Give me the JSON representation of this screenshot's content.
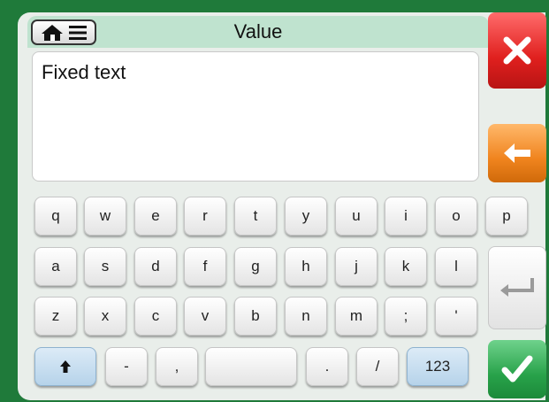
{
  "header": {
    "title": "Value"
  },
  "editor": {
    "value": "Fixed text"
  },
  "keyboard": {
    "row1": [
      "q",
      "w",
      "e",
      "r",
      "t",
      "y",
      "u",
      "i",
      "o",
      "p"
    ],
    "row2": [
      "a",
      "s",
      "d",
      "f",
      "g",
      "h",
      "j",
      "k",
      "l"
    ],
    "row3": [
      "z",
      "x",
      "c",
      "v",
      "b",
      "n",
      "m",
      ";",
      "'"
    ],
    "row4": {
      "minus": "-",
      "comma": ",",
      "period": ".",
      "slash": "/",
      "numbers": "123"
    }
  },
  "icons": {
    "home": "home-icon",
    "menu": "menu-icon",
    "close": "close-icon",
    "back": "arrow-left-icon",
    "enter": "enter-icon",
    "ok": "checkmark-icon",
    "shift": "shift-icon"
  },
  "colors": {
    "background": "#1f7a3a",
    "titlebar": "#bfe3cf",
    "close": "#e0201e",
    "back": "#f0841e",
    "ok": "#28a24a",
    "blue_key": "#b6d3ea"
  }
}
